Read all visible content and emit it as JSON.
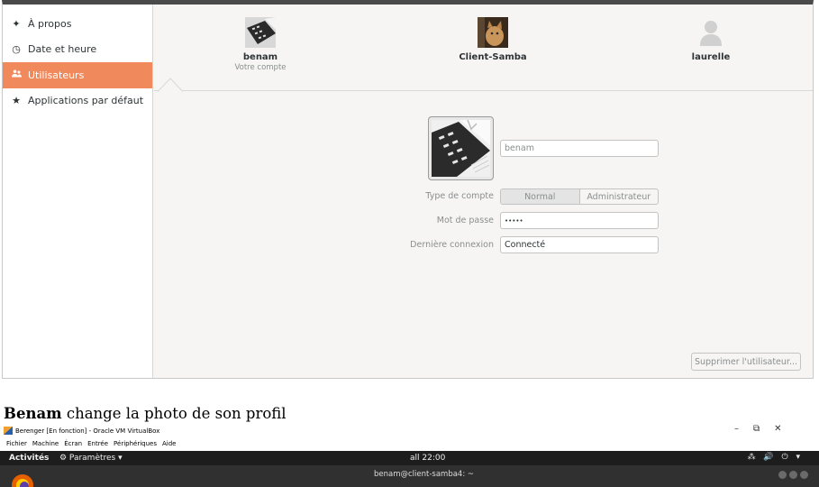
{
  "sidebar": {
    "items": [
      {
        "label": "À propos",
        "icon": "sparkle-icon",
        "glyph": "✦"
      },
      {
        "label": "Date et heure",
        "icon": "clock-icon",
        "glyph": "◷"
      },
      {
        "label": "Utilisateurs",
        "icon": "users-icon",
        "glyph": "👥"
      },
      {
        "label": "Applications par défaut",
        "icon": "star-icon",
        "glyph": "★"
      }
    ],
    "active_index": 2,
    "active_color": "#f08a5d"
  },
  "users": [
    {
      "name": "benam",
      "subtitle": "Votre compte"
    },
    {
      "name": "Client-Samba"
    },
    {
      "name": "laurelle"
    }
  ],
  "user_form": {
    "username": "benam",
    "account_type_label": "Type de compte",
    "account_type_options": [
      "Normal",
      "Administrateur"
    ],
    "account_type_selected": "Normal",
    "password_label": "Mot de passe",
    "password_value": "•••••",
    "last_login_label": "Dernière connexion",
    "last_login_value": "Connecté",
    "delete_button": "Supprimer l'utilisateur..."
  },
  "caption": {
    "bold": "Benam",
    "text": " change la photo de son profil"
  },
  "vbox": {
    "title": "Berenger [En fonction] - Oracle VM VirtualBox",
    "menu": [
      "Fichier",
      "Machine",
      "Écran",
      "Entrée",
      "Périphériques",
      "Aide"
    ],
    "controls": {
      "minimize": "–",
      "restore": "⧉",
      "close": "✕"
    }
  },
  "gnome_bar": {
    "activities": "Activités",
    "app_menu": "⚙ Paramètres ▾",
    "clock": "all 22:00",
    "tray": "⁂ 🔊 ⏻ ▾"
  },
  "terminal": {
    "title": "benam@client-samba4: ~"
  }
}
